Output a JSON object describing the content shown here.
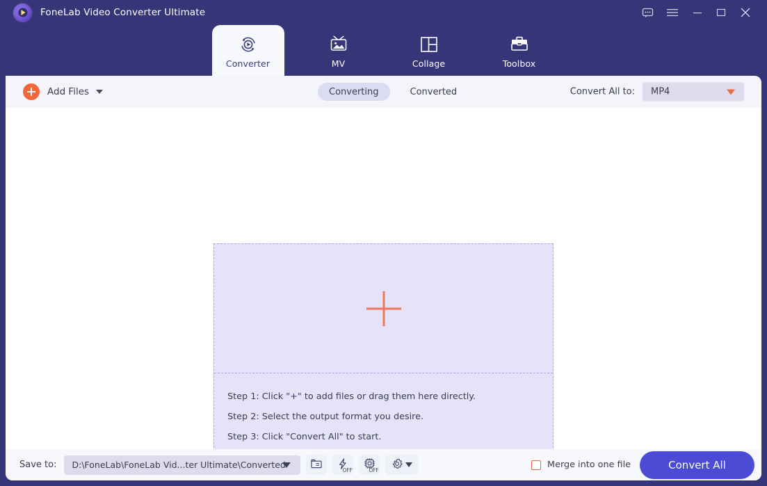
{
  "window": {
    "title": "FoneLab Video Converter Ultimate",
    "logo_icon": "fonelab-play-logo-icon",
    "controls": [
      {
        "name": "feedback-icon",
        "glyph": "chat-bubble-icon"
      },
      {
        "name": "menu-icon",
        "glyph": "hamburger-icon"
      },
      {
        "name": "minimize-icon",
        "glyph": "minimize-icon"
      },
      {
        "name": "maximize-icon",
        "glyph": "maximize-icon"
      },
      {
        "name": "close-icon",
        "glyph": "close-icon"
      }
    ]
  },
  "tabs": [
    {
      "id": "converter",
      "label": "Converter",
      "icon": "convert-refresh-play-icon",
      "active": true
    },
    {
      "id": "mv",
      "label": "MV",
      "icon": "tv-photo-icon",
      "active": false
    },
    {
      "id": "collage",
      "label": "Collage",
      "icon": "grid-layout-icon",
      "active": false
    },
    {
      "id": "toolbox",
      "label": "Toolbox",
      "icon": "toolbox-briefcase-icon",
      "active": false
    }
  ],
  "toolbar": {
    "add_files_label": "Add Files",
    "add_files_icon": "plus-circle-icon",
    "add_files_caret": "chevron-down-icon",
    "segments": [
      {
        "id": "converting",
        "label": "Converting",
        "active": true
      },
      {
        "id": "converted",
        "label": "Converted",
        "active": false
      }
    ],
    "convert_all_to_label": "Convert All to:",
    "convert_all_to_value": "MP4",
    "convert_all_to_caret": "caret-down-icon"
  },
  "dropzone": {
    "plus_icon": "large-plus-icon",
    "steps": [
      "Step 1: Click \"+\" to add files or drag them here directly.",
      "Step 2: Select the output format you desire.",
      "Step 3: Click \"Convert All\" to start."
    ]
  },
  "bottom_bar": {
    "save_to_label": "Save to:",
    "save_to_path": "D:\\FoneLab\\FoneLab Vid...ter Ultimate\\Converted",
    "path_caret": "caret-down-icon",
    "buttons": [
      {
        "name": "open-folder-button",
        "icon": "folder-icon",
        "badge": ""
      },
      {
        "name": "hardware-accel-button",
        "icon": "lightning-bolt-icon",
        "badge": "OFF"
      },
      {
        "name": "gpu-accel-button",
        "icon": "cpu-chip-icon",
        "badge": "OFF"
      },
      {
        "name": "preferences-button",
        "icon": "gear-icon",
        "badge": ""
      }
    ],
    "merge_label": "Merge into one file",
    "merge_checked": false,
    "convert_all_label": "Convert All"
  },
  "colors": {
    "window_bg": "#353577",
    "panel_bg": "#ffffff",
    "toolbar_bg": "#f3f5fb",
    "accent_orange": "#f2663c",
    "accent_blue": "#4b4bd6",
    "dropzone_bg": "#e4e3fa",
    "dropzone_border": "#a8a4e0"
  }
}
